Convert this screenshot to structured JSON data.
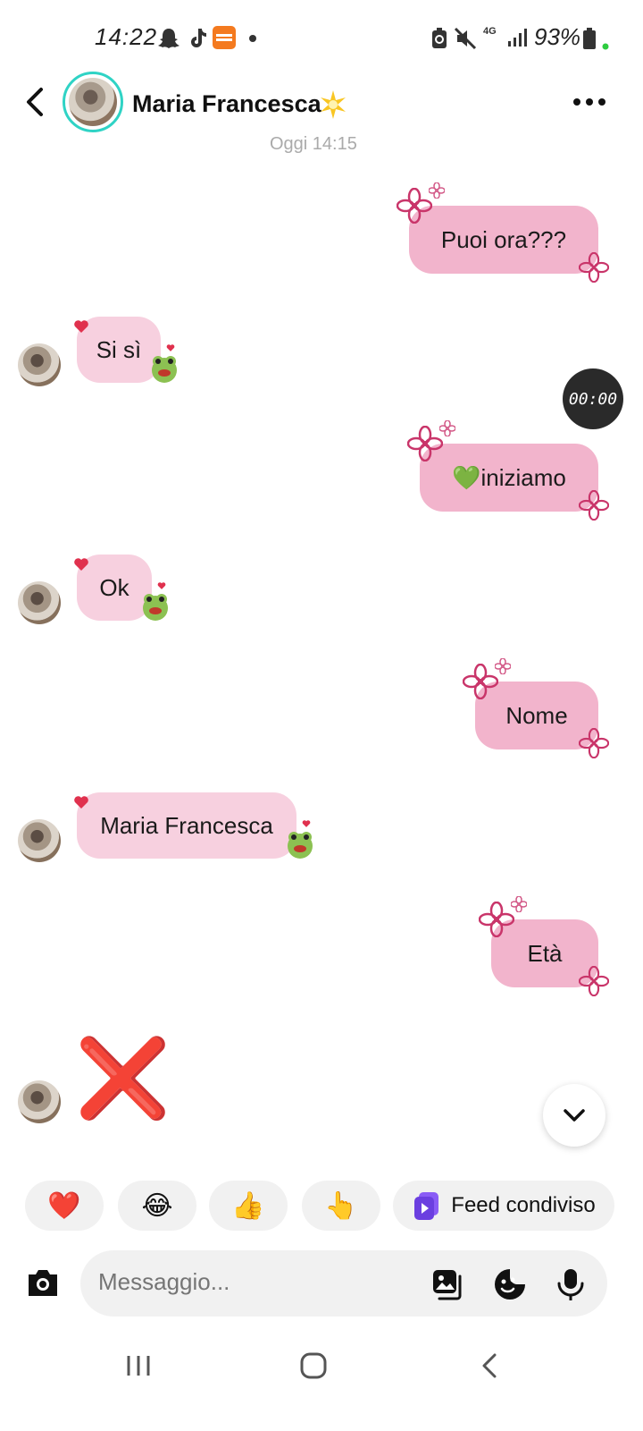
{
  "status_bar": {
    "time": "14:22",
    "battery": "93%",
    "network": "4G",
    "icons_left": [
      "snapchat-icon",
      "tiktok-icon",
      "temu-icon",
      "dot-icon"
    ],
    "icons_right": [
      "battery-saver-icon",
      "mute-icon",
      "network-icon",
      "signal-icon",
      "battery-icon"
    ]
  },
  "header": {
    "contact_name": "Maria Francesca",
    "name_emoji": "star-icon",
    "ring_color": "#2fd3c5"
  },
  "conversation": {
    "timestamp": "Oggi 14:15",
    "messages": [
      {
        "direction": "outgoing",
        "text": "Puoi ora???"
      },
      {
        "direction": "incoming",
        "text": "Si sì"
      },
      {
        "direction": "outgoing",
        "text": "iniziamo",
        "prefix_emoji": "💚"
      },
      {
        "direction": "incoming",
        "text": "Ok"
      },
      {
        "direction": "outgoing",
        "text": "Nome"
      },
      {
        "direction": "incoming",
        "text": "Maria Francesca"
      },
      {
        "direction": "outgoing",
        "text": "Età"
      },
      {
        "direction": "incoming",
        "text": "❌",
        "kind": "emoji"
      }
    ],
    "timer": "00:00"
  },
  "quick_reactions": {
    "items": [
      "❤️",
      "😂",
      "👍",
      "👆"
    ],
    "feed_label": "Feed condiviso"
  },
  "composer": {
    "placeholder": "Messaggio...",
    "icons": [
      "camera-icon",
      "gallery-icon",
      "sticker-icon",
      "microphone-icon"
    ]
  },
  "colors": {
    "outgoing_bubble": "#f2b4cc",
    "incoming_bubble": "#f7d0df",
    "flower": "#c9356a"
  }
}
